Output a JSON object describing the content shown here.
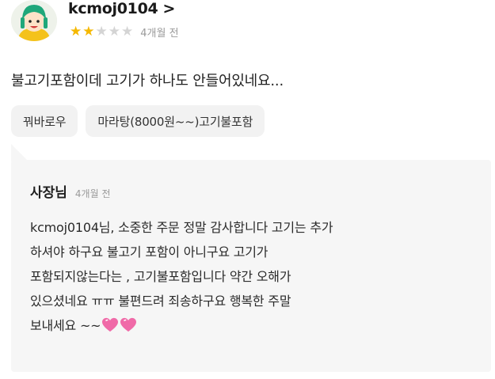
{
  "review": {
    "username": "kcmoj0104",
    "chevron_glyph": ">",
    "rating": 2,
    "rating_max": 5,
    "time": "4개월 전",
    "text": "불고기포함이데 고기가 하나도 안들어있네요...",
    "menu_tags": [
      "꿔바로우",
      "마라탕(8000원~~)고기불포함"
    ]
  },
  "owner_reply": {
    "author": "사장님",
    "time": "4개월 전",
    "lines": [
      "kcmoj0104님, 소중한 주문 정말 감사합니다  고기는 추가",
      "하셔야 하구요 불고기 포함이 아니구요 고기가",
      "포함되지않는다는 , 고기불포함입니다 약간 오해가",
      "있으셨네요 ㅠㅠ 불편드려 죄송하구요 행복한 주말",
      "보내세요 ~~"
    ],
    "trailing_icons": [
      "sparkling-heart-icon",
      "sparkling-heart-icon"
    ]
  },
  "colors": {
    "star_on": "#f5b800",
    "star_off": "#d4d4d4",
    "reply_bg": "#f6f6f6",
    "tag_bg": "#f2f2f2",
    "heart": "#f06aa8"
  }
}
